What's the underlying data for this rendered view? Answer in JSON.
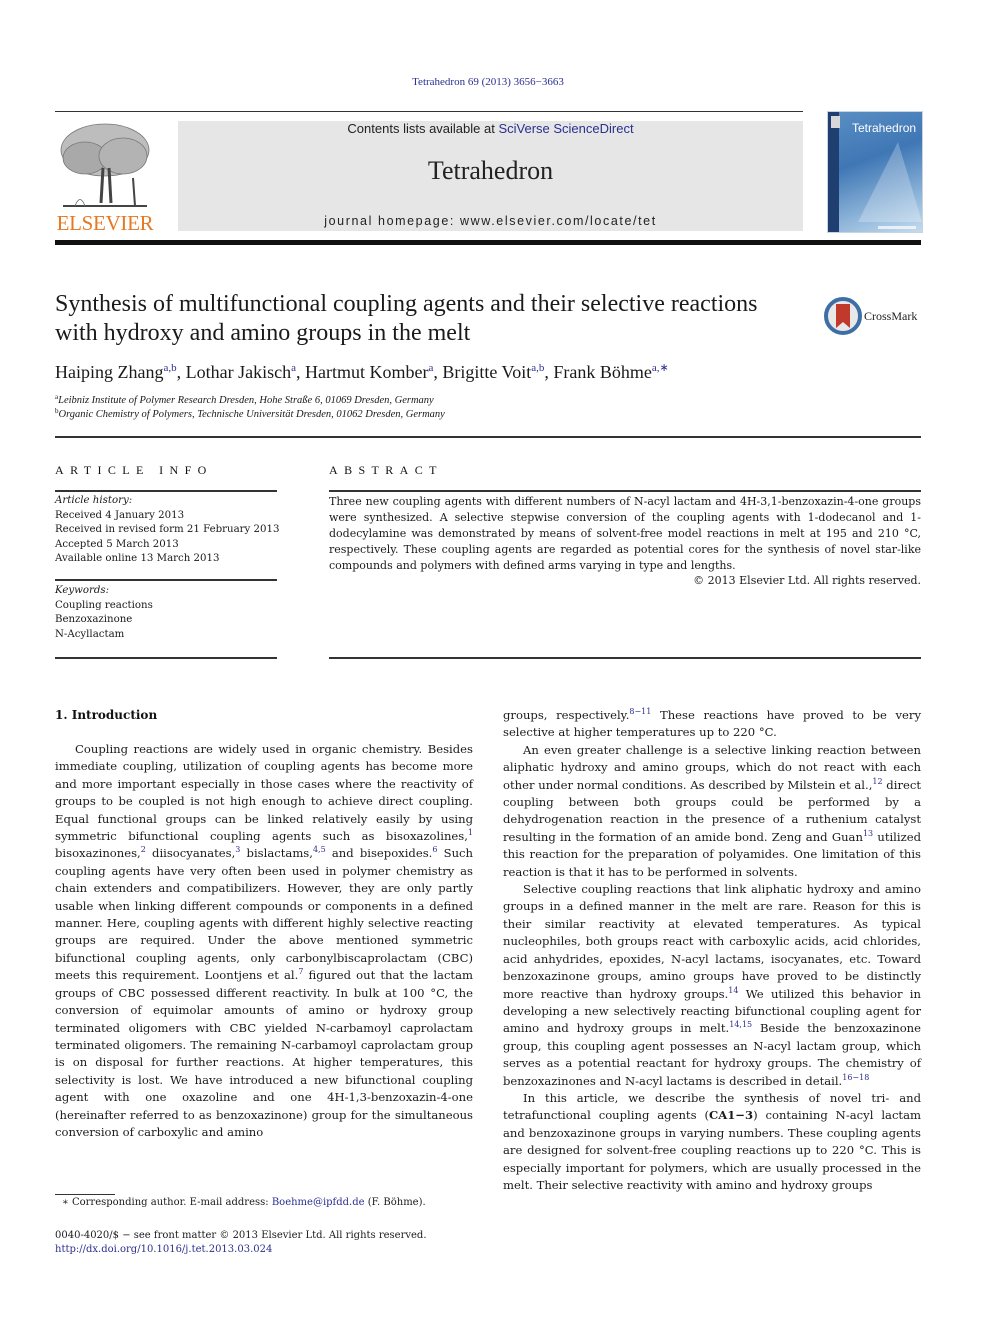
{
  "citation": "Tetrahedron 69 (2013) 3656−3663",
  "header": {
    "publisher": "ELSEVIER",
    "contents_prefix": "Contents lists available at ",
    "contents_link": "SciVerse ScienceDirect",
    "journal": "Tetrahedron",
    "homepage": "journal homepage: www.elsevier.com/locate/tet",
    "cover_title": "Tetrahedron"
  },
  "article": {
    "title": "Synthesis of multifunctional coupling agents and their selective reactions with hydroxy and amino groups in the melt",
    "crossmark": "CrossMark",
    "authors": [
      {
        "name": "Haiping Zhang",
        "sup": "a,b",
        "sep": ", "
      },
      {
        "name": "Lothar Jakisch",
        "sup": "a",
        "sep": ", "
      },
      {
        "name": "Hartmut Komber",
        "sup": "a",
        "sep": ", "
      },
      {
        "name": "Brigitte Voit",
        "sup": "a,b",
        "sep": ", "
      },
      {
        "name": "Frank Böhme",
        "sup": "a,∗",
        "sep": ""
      }
    ],
    "affiliations": [
      {
        "key": "a",
        "text": "Leibniz Institute of Polymer Research Dresden, Hohe Straße 6, 01069 Dresden, Germany"
      },
      {
        "key": "b",
        "text": "Organic Chemistry of Polymers, Technische Universität Dresden, 01062 Dresden, Germany"
      }
    ]
  },
  "article_info": {
    "heading": "ARTICLE INFO",
    "history_label": "Article history:",
    "history": [
      "Received 4 January 2013",
      "Received in revised form 21 February 2013",
      "Accepted 5 March 2013",
      "Available online 13 March 2013"
    ],
    "keywords_label": "Keywords:",
    "keywords": [
      "Coupling reactions",
      "Benzoxazinone",
      "N-Acyllactam"
    ]
  },
  "abstract": {
    "heading": "ABSTRACT",
    "text": "Three new coupling agents with different numbers of N-acyl lactam and 4H-3,1-benzoxazin-4-one groups were synthesized. A selective stepwise conversion of the coupling agents with 1-dodecanol and 1-dodecylamine was demonstrated by means of solvent-free model reactions in melt at 195 and 210 °C, respectively. These coupling agents are regarded as potential cores for the synthesis of novel star-like compounds and polymers with defined arms varying in type and lengths.",
    "copyright": "© 2013 Elsevier Ltd. All rights reserved."
  },
  "body": {
    "section_heading": "1.  Introduction",
    "left_paragraphs": [
      "Coupling reactions are widely used in organic chemistry. Besides immediate coupling, utilization of coupling agents has become more and more important especially in those cases where the reactivity of groups to be coupled is not high enough to achieve direct coupling. Equal functional groups can be linked relatively easily by using symmetric bifunctional coupling agents such as bisoxazolines,[1] bisoxazinones,[2] diisocyanates,[3] bislactams,[4,5] and bisepoxides.[6] Such coupling agents have very often been used in polymer chemistry as chain extenders and compatibilizers. However, they are only partly usable when linking different compounds or components in a defined manner. Here, coupling agents with different highly selective reacting groups are required. Under the above mentioned symmetric bifunctional coupling agents, only carbonylbiscaprolactam (CBC) meets this requirement. Loontjens et al.[7] figured out that the lactam groups of CBC possessed different reactivity. In bulk at 100 °C, the conversion of equimolar amounts of amino or hydroxy group terminated oligomers with CBC yielded N-carbamoyl caprolactam terminated oligomers. The remaining N-carbamoyl caprolactam group is on disposal for further reactions. At higher temperatures, this selectivity is lost. We have introduced a new bifunctional coupling agent with one oxazoline and one 4H-1,3-benzoxazin-4-one (hereinafter referred to as benzoxazinone) group for the simultaneous conversion of carboxylic and amino"
    ],
    "right_paragraphs": [
      "groups, respectively.[8−11] These reactions have proved to be very selective at higher temperatures up to 220 °C.",
      "An even greater challenge is a selective linking reaction between aliphatic hydroxy and amino groups, which do not react with each other under normal conditions. As described by Milstein et al.,[12] direct coupling between both groups could be performed by a dehydrogenation reaction in the presence of a ruthenium catalyst resulting in the formation of an amide bond. Zeng and Guan[13] utilized this reaction for the preparation of polyamides. One limitation of this reaction is that it has to be performed in solvents.",
      "Selective coupling reactions that link aliphatic hydroxy and amino groups in a defined manner in the melt are rare. Reason for this is their similar reactivity at elevated temperatures. As typical nucleophiles, both groups react with carboxylic acids, acid chlorides, acid anhydrides, epoxides, N-acyl lactams, isocyanates, etc. Toward benzoxazinone groups, amino groups have proved to be distinctly more reactive than hydroxy groups.[14] We utilized this behavior in developing a new selectively reacting bifunctional coupling agent for amino and hydroxy groups in melt.[14,15] Beside the benzoxazinone group, this coupling agent possesses an N-acyl lactam group, which serves as a potential reactant for hydroxy groups. The chemistry of benzoxazinones and N-acyl lactams is described in detail.[16−18]",
      "In this article, we describe the synthesis of novel tri- and tetrafunctional coupling agents (**CA1−3**) containing N-acyl lactam and benzoxazinone groups in varying numbers. These coupling agents are designed for solvent-free coupling reactions up to 220 °C. This is especially important for polymers, which are usually processed in the melt. Their selective reactivity with amino and hydroxy groups"
    ]
  },
  "footnote": {
    "prefix": "∗ Corresponding author. E-mail address: ",
    "email": "Boehme@ipfdd.de",
    "suffix": " (F. Böhme)."
  },
  "front_matter": {
    "issn_line": "0040-4020/$ − see front matter © 2013 Elsevier Ltd. All rights reserved.",
    "doi": "http://dx.doi.org/10.1016/j.tet.2013.03.024"
  },
  "colors": {
    "link": "#2b2f8f",
    "elsevier_orange": "#e87722",
    "band_gray": "#e6e6e6"
  }
}
